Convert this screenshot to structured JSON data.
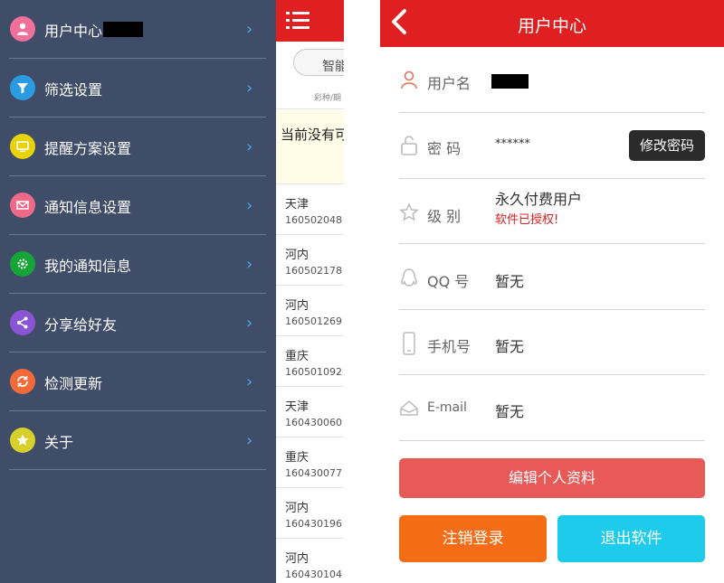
{
  "drawer": {
    "items": [
      {
        "label": "用户中心",
        "icon": "user-icon",
        "color": "#f0709a"
      },
      {
        "label": "筛选设置",
        "icon": "filter-icon",
        "color": "#2a9be0"
      },
      {
        "label": "提醒方案设置",
        "icon": "monitor-icon",
        "color": "#e8d20a"
      },
      {
        "label": "通知信息设置",
        "icon": "envelope-icon",
        "color": "#ee6888"
      },
      {
        "label": "我的通知信息",
        "icon": "gear-icon",
        "color": "#16a436"
      },
      {
        "label": "分享给好友",
        "icon": "share-icon",
        "color": "#8a55d4"
      },
      {
        "label": "检测更新",
        "icon": "refresh-icon",
        "color": "#f26a3a"
      },
      {
        "label": "关于",
        "icon": "star-icon",
        "color": "#d8d02a"
      }
    ]
  },
  "middle": {
    "pill_text": "智能",
    "column_header": "彩种/期",
    "notice": "当前没有可",
    "rows": [
      {
        "city": "天津",
        "num": "160502048"
      },
      {
        "city": "河内",
        "num": "160502178"
      },
      {
        "city": "河内",
        "num": "160501269"
      },
      {
        "city": "重庆",
        "num": "160501092"
      },
      {
        "city": "天津",
        "num": "160430060"
      },
      {
        "city": "重庆",
        "num": "160430077"
      },
      {
        "city": "河内",
        "num": "160430196"
      },
      {
        "city": "河内",
        "num": "160430104"
      }
    ]
  },
  "profile": {
    "title": "用户中心",
    "username_label": "用户名",
    "password_label": "密 码",
    "password_value": "******",
    "change_password": "修改密码",
    "level_label": "级 别",
    "level_value": "永久付费用户",
    "level_status": "软件已授权!",
    "qq_label": "QQ 号",
    "qq_value": "暂无",
    "phone_label": "手机号",
    "phone_value": "暂无",
    "email_label": "E-mail",
    "email_value": "暂无",
    "edit_button": "编辑个人资料",
    "logout_button": "注销登录",
    "exit_button": "退出软件"
  },
  "colors": {
    "drawer_bg": "#3f4d69",
    "header_red": "#e02020",
    "edit_btn": "#e85a58",
    "logout_btn": "#f46c15",
    "exit_btn": "#1ecbeb",
    "chevron": "#4aa9e8"
  }
}
